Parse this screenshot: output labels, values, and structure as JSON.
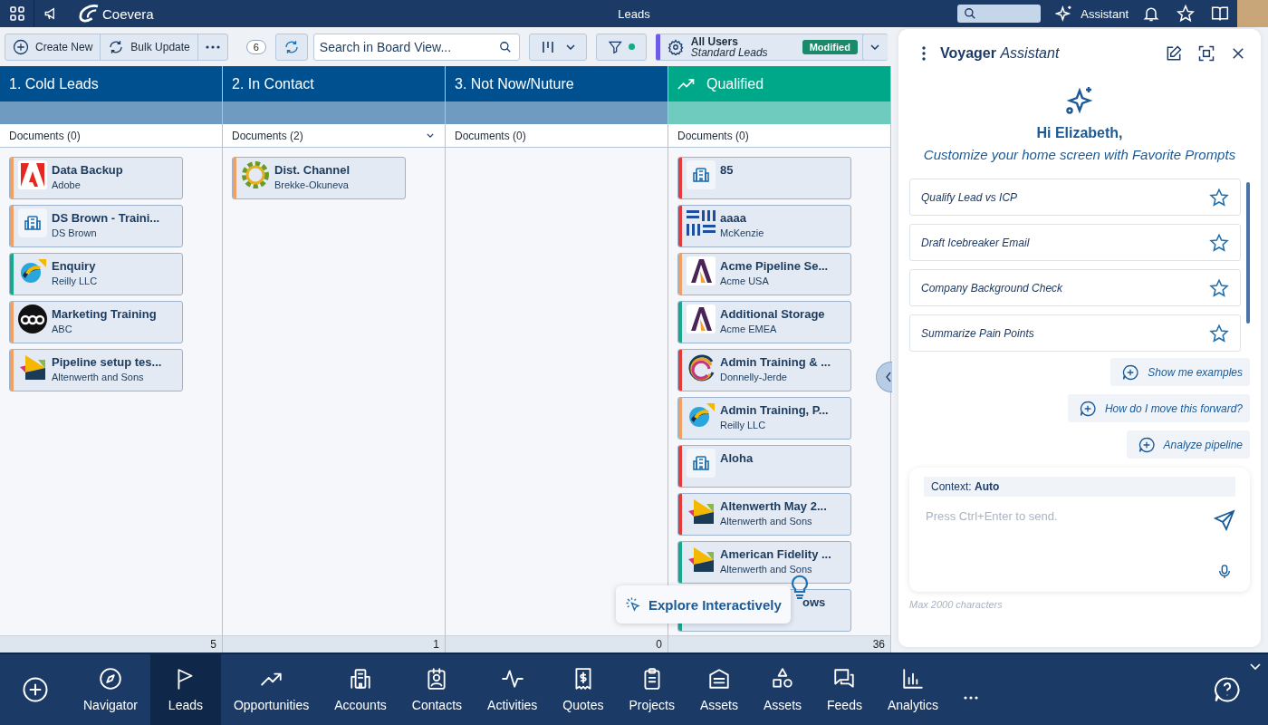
{
  "topbar": {
    "title": "Leads",
    "brand": "Coevera",
    "assistant_button": "Assistant"
  },
  "toolbar": {
    "create": "Create New",
    "bulk": "Bulk Update",
    "count": "6",
    "search_placeholder": "Search in Board View...",
    "filter_active": true,
    "view": {
      "name": "All Users",
      "subtitle": "Standard Leads",
      "badge": "Modified"
    }
  },
  "columns": [
    {
      "title": "1. Cold Leads",
      "color": "#00508f",
      "trend": false,
      "documents": "Documents (0)",
      "expandable": false,
      "count": "5",
      "cards": [
        {
          "title": "Data Backup",
          "subtitle": "Adobe",
          "kind": "adobe",
          "color": "#f0a062",
          "covered": false
        },
        {
          "title": "DS Brown - Traini...",
          "subtitle": "DS Brown",
          "kind": "building",
          "color": "#f0a062",
          "covered": false
        },
        {
          "title": "Enquiry",
          "subtitle": "Reilly LLC",
          "kind": "swirl",
          "color": "#1aa88a",
          "covered": false
        },
        {
          "title": "Marketing Training",
          "subtitle": "ABC",
          "kind": "abc",
          "color": "#f0a062",
          "covered": false
        },
        {
          "title": "Pipeline setup tes...",
          "subtitle": "Altenwerth and Sons",
          "kind": "prism",
          "color": "#f0a062",
          "covered": false
        }
      ]
    },
    {
      "title": "2. In Contact",
      "color": "#00508f",
      "trend": false,
      "documents": "Documents (2)",
      "expandable": true,
      "count": "1",
      "cards": [
        {
          "title": "Dist. Channel",
          "subtitle": "Brekke-Okuneva",
          "kind": "flower",
          "color": "#f0a062",
          "covered": false
        }
      ]
    },
    {
      "title": "3. Not Now/Nuture",
      "color": "#00508f",
      "trend": false,
      "documents": "Documents (0)",
      "expandable": false,
      "count": "0"
    },
    {
      "title": "Qualified",
      "color": "#00a88a",
      "trend": true,
      "documents": "Documents (0)",
      "expandable": false,
      "count": "36",
      "cards": [
        {
          "title": "85",
          "kind": "building",
          "color": "#e53a3a",
          "covered": false
        },
        {
          "title": "aaaa",
          "subtitle": "McKenzie",
          "kind": "bars",
          "color": "#e53a3a",
          "covered": false
        },
        {
          "title": "Acme Pipeline Se...",
          "subtitle": "Acme USA",
          "kind": "acme",
          "color": "#f0a062",
          "covered": false
        },
        {
          "title": "Additional Storage",
          "subtitle": "Acme EMEA",
          "kind": "acme",
          "color": "#1aa88a",
          "covered": false
        },
        {
          "title": "Admin Training & ...",
          "subtitle": "Donnelly-Jerde",
          "kind": "ring",
          "color": "#e53a3a",
          "covered": false
        },
        {
          "title": "Admin Training, P...",
          "subtitle": "Reilly LLC",
          "kind": "swirl",
          "color": "#f0a062",
          "covered": false
        },
        {
          "title": "Aloha",
          "kind": "building",
          "color": "#e53a3a",
          "covered": false
        },
        {
          "title": "Altenwerth May 2...",
          "subtitle": "Altenwerth and Sons",
          "kind": "prism",
          "color": "#e53a3a",
          "covered": false
        },
        {
          "title": "American Fidelity ...",
          "subtitle": "Altenwerth and Sons",
          "kind": "prism",
          "color": "#1aa88a",
          "covered": false
        },
        {
          "title": "ows",
          "kind": "none",
          "color": "#1aa88a",
          "covered": true
        }
      ]
    }
  ],
  "explore": "Explore Interactively",
  "assistant": {
    "title": "**Voyager** *Assistant*",
    "greeting": "Hi Elizabeth,",
    "subtitle": "Customize your home screen with Favorite Prompts",
    "prompts": [
      {
        "label": "Qualify Lead vs ICP",
        "starred": false
      },
      {
        "label": "Draft Icebreaker Email",
        "starred": false
      },
      {
        "label": "Company Background Check",
        "starred": false
      },
      {
        "label": "Summarize Pain Points",
        "starred": false
      }
    ],
    "suggestions": [
      "Show me examples",
      "How do I move this forward?",
      "Analyze pipeline"
    ],
    "context": "Context: **Auto**",
    "placeholder": "Press Ctrl+Enter to send.",
    "limit": "Max 2000 characters"
  },
  "nav": [
    {
      "label": "Navigator",
      "kind": "compass",
      "selected": false
    },
    {
      "label": "Leads",
      "kind": "flag",
      "selected": true
    },
    {
      "label": "Opportunities",
      "kind": "trend",
      "selected": false
    },
    {
      "label": "Accounts",
      "kind": "building",
      "selected": false
    },
    {
      "label": "Contacts",
      "kind": "contact",
      "selected": false
    },
    {
      "label": "Activities",
      "kind": "pulse",
      "selected": false
    },
    {
      "label": "Quotes",
      "kind": "receipt",
      "selected": false
    },
    {
      "label": "Projects",
      "kind": "clipboard",
      "selected": false
    },
    {
      "label": "Assets",
      "kind": "archive",
      "selected": false
    },
    {
      "label": "Assets",
      "kind": "shapes",
      "selected": false
    },
    {
      "label": "Feeds",
      "kind": "chat",
      "selected": false
    },
    {
      "label": "Analytics",
      "kind": "chart",
      "selected": false
    }
  ]
}
